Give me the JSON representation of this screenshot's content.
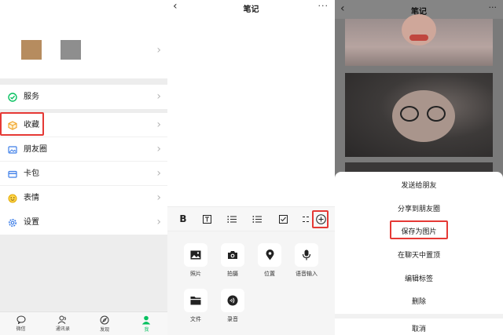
{
  "me_screen": {
    "menu": [
      {
        "label": "服务",
        "icon": "service-icon"
      },
      {
        "label": "收藏",
        "icon": "favorites-cube-icon"
      },
      {
        "label": "朋友圈",
        "icon": "moments-photo-icon"
      },
      {
        "label": "卡包",
        "icon": "card-wallet-icon"
      },
      {
        "label": "表情",
        "icon": "emoji-icon"
      },
      {
        "label": "设置",
        "icon": "gear-icon"
      }
    ],
    "tabbar": [
      {
        "label": "微信",
        "icon": "chat-bubble-icon"
      },
      {
        "label": "通讯录",
        "icon": "contacts-icon"
      },
      {
        "label": "发现",
        "icon": "compass-icon"
      },
      {
        "label": "我",
        "icon": "person-icon",
        "active": true
      }
    ],
    "accent": "#07c160",
    "highlight_color": "#e53935"
  },
  "note_editor": {
    "title": "笔记",
    "toolbar": [
      "bold-icon",
      "text-box-icon",
      "numbered-list-icon",
      "bullet-list-icon",
      "checkbox-icon",
      "indent-icon",
      "plus-circle-icon"
    ],
    "apps": [
      {
        "label": "照片",
        "icon": "photo-icon"
      },
      {
        "label": "拍摄",
        "icon": "camera-icon"
      },
      {
        "label": "位置",
        "icon": "location-pin-icon"
      },
      {
        "label": "语音输入",
        "icon": "microphone-icon"
      },
      {
        "label": "文件",
        "icon": "file-folder-icon"
      },
      {
        "label": "录音",
        "icon": "recording-icon"
      }
    ]
  },
  "action_sheet": {
    "title": "笔记",
    "options": [
      "发送给朋友",
      "分享到朋友圈",
      "保存为图片",
      "在聊天中置顶",
      "编辑标签",
      "删除"
    ],
    "cancel": "取消"
  }
}
